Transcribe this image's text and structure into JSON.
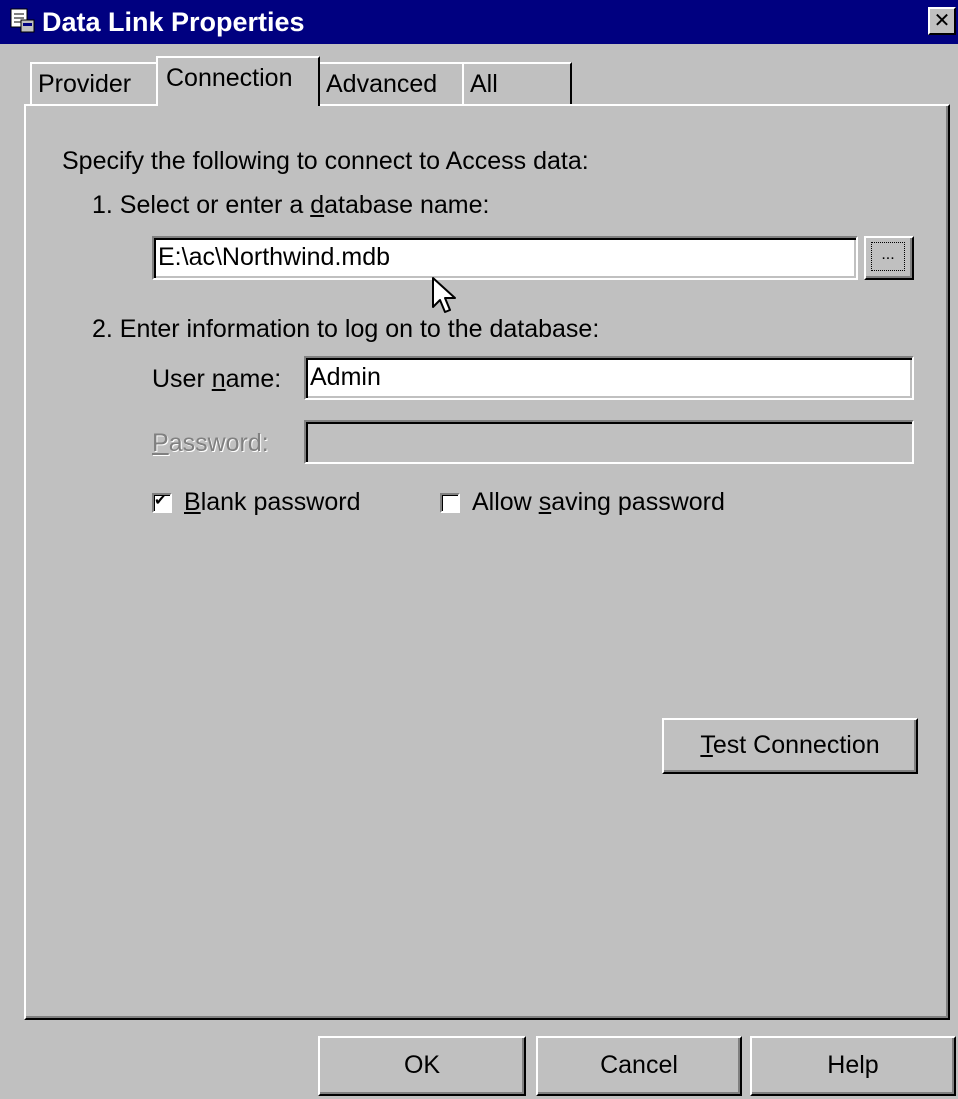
{
  "window": {
    "title": "Data Link Properties",
    "close_glyph": "✕"
  },
  "tabs": [
    {
      "label": "Provider",
      "active": false
    },
    {
      "label": "Connection",
      "active": true
    },
    {
      "label": "Advanced",
      "active": false
    },
    {
      "label": "All",
      "active": false
    }
  ],
  "connection": {
    "intro": "Specify the following to connect to Access data:",
    "step1": {
      "before": "1. Select or enter a ",
      "accel": "d",
      "after": "atabase name:"
    },
    "database_name": "E:\\ac\\Northwind.mdb",
    "browse_label": "...",
    "step2": "2. Enter information to log on to the database:",
    "user_name_label": {
      "before": "User ",
      "accel": "n",
      "after": "ame:"
    },
    "user_name_value": "Admin",
    "password_label": {
      "before": "",
      "accel": "P",
      "after": "assword:"
    },
    "password_value": "",
    "blank_password": {
      "before": "",
      "accel": "B",
      "after": "lank password",
      "checked": true
    },
    "allow_saving": {
      "before": "Allow ",
      "accel": "s",
      "after": "aving password",
      "checked": false
    },
    "test_connection": {
      "before": "",
      "accel": "T",
      "after": "est Connection"
    }
  },
  "buttons": {
    "ok": "OK",
    "cancel": "Cancel",
    "help": "Help"
  },
  "icons": {
    "title": "data-link-icon",
    "check": "✔"
  }
}
